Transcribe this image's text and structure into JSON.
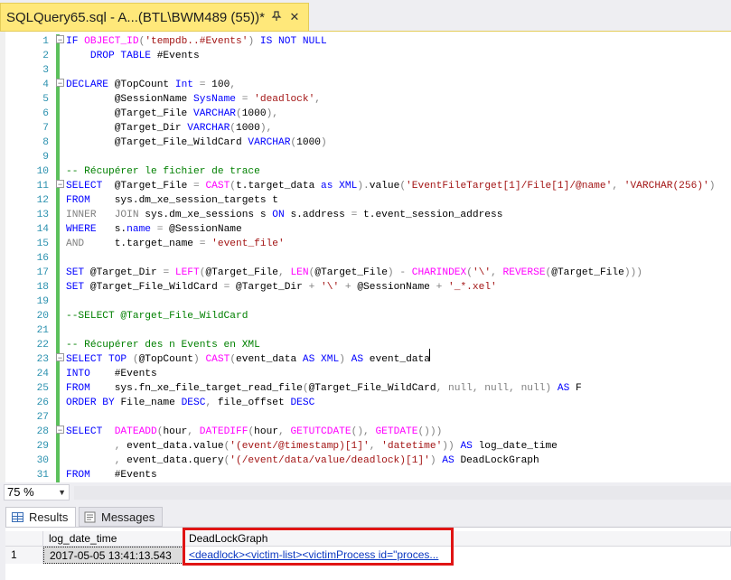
{
  "tab": {
    "title": "SQLQuery65.sql - A...(BTL\\BWM489 (55))*",
    "pin_icon": "pin-icon",
    "close_icon": "close-icon"
  },
  "editor": {
    "lines": [
      {
        "n": "1",
        "t": [
          [
            "k",
            "IF "
          ],
          [
            "f",
            "OBJECT_ID"
          ],
          [
            "g",
            "("
          ],
          [
            "s",
            "'tempdb..#Events'"
          ],
          [
            "g",
            ")"
          ],
          [
            "k",
            " IS NOT NULL"
          ]
        ]
      },
      {
        "n": "2",
        "t": [
          [
            "k",
            "    DROP TABLE "
          ],
          [
            "",
            "#Events"
          ]
        ]
      },
      {
        "n": "3",
        "t": []
      },
      {
        "n": "4",
        "t": [
          [
            "k",
            "DECLARE "
          ],
          [
            "",
            "@TopCount "
          ],
          [
            "k",
            "Int "
          ],
          [
            "g",
            "= "
          ],
          [
            "",
            "100"
          ],
          [
            "g",
            ","
          ]
        ]
      },
      {
        "n": "5",
        "t": [
          [
            "",
            "        @SessionName "
          ],
          [
            "k",
            "SysName "
          ],
          [
            "g",
            "= "
          ],
          [
            "s",
            "'deadlock'"
          ],
          [
            "g",
            ","
          ]
        ]
      },
      {
        "n": "6",
        "t": [
          [
            "",
            "        @Target_File "
          ],
          [
            "k",
            "VARCHAR"
          ],
          [
            "g",
            "("
          ],
          [
            "",
            "1000"
          ],
          [
            "g",
            "),"
          ]
        ]
      },
      {
        "n": "7",
        "t": [
          [
            "",
            "        @Target_Dir "
          ],
          [
            "k",
            "VARCHAR"
          ],
          [
            "g",
            "("
          ],
          [
            "",
            "1000"
          ],
          [
            "g",
            "),"
          ]
        ]
      },
      {
        "n": "8",
        "t": [
          [
            "",
            "        @Target_File_WildCard "
          ],
          [
            "k",
            "VARCHAR"
          ],
          [
            "g",
            "("
          ],
          [
            "",
            "1000"
          ],
          [
            "g",
            ")"
          ]
        ]
      },
      {
        "n": "9",
        "t": []
      },
      {
        "n": "10",
        "t": [
          [
            "c",
            "-- Récupérer le fichier de trace"
          ]
        ]
      },
      {
        "n": "11",
        "t": [
          [
            "k",
            "SELECT  "
          ],
          [
            "",
            "@Target_File "
          ],
          [
            "g",
            "= "
          ],
          [
            "f",
            "CAST"
          ],
          [
            "g",
            "("
          ],
          [
            "",
            "t.target_data "
          ],
          [
            "k",
            "as XML"
          ],
          [
            "g",
            ")."
          ],
          [
            "",
            "value"
          ],
          [
            "g",
            "("
          ],
          [
            "s",
            "'EventFileTarget[1]/File[1]/@name'"
          ],
          [
            "g",
            ", "
          ],
          [
            "s",
            "'VARCHAR(256)'"
          ],
          [
            "g",
            ")"
          ]
        ]
      },
      {
        "n": "12",
        "t": [
          [
            "k",
            "FROM    "
          ],
          [
            "",
            "sys.dm_xe_session_targets t"
          ]
        ]
      },
      {
        "n": "13",
        "t": [
          [
            "g",
            "INNER   JOIN "
          ],
          [
            "",
            "sys.dm_xe_sessions s "
          ],
          [
            "k",
            "ON "
          ],
          [
            "",
            "s.address "
          ],
          [
            "g",
            "= "
          ],
          [
            "",
            "t.event_session_address"
          ]
        ]
      },
      {
        "n": "14",
        "t": [
          [
            "k",
            "WHERE   "
          ],
          [
            "",
            "s."
          ],
          [
            "k",
            "name "
          ],
          [
            "g",
            "= "
          ],
          [
            "",
            "@SessionName"
          ]
        ]
      },
      {
        "n": "15",
        "t": [
          [
            "g",
            "AND     "
          ],
          [
            "",
            "t.target_name "
          ],
          [
            "g",
            "= "
          ],
          [
            "s",
            "'event_file'"
          ]
        ]
      },
      {
        "n": "16",
        "t": []
      },
      {
        "n": "17",
        "t": [
          [
            "k",
            "SET "
          ],
          [
            "",
            "@Target_Dir "
          ],
          [
            "g",
            "= "
          ],
          [
            "f",
            "LEFT"
          ],
          [
            "g",
            "("
          ],
          [
            "",
            "@Target_File"
          ],
          [
            "g",
            ", "
          ],
          [
            "f",
            "LEN"
          ],
          [
            "g",
            "("
          ],
          [
            "",
            "@Target_File"
          ],
          [
            "g",
            ") - "
          ],
          [
            "f",
            "CHARINDEX"
          ],
          [
            "g",
            "("
          ],
          [
            "s",
            "'\\'"
          ],
          [
            "g",
            ", "
          ],
          [
            "f",
            "REVERSE"
          ],
          [
            "g",
            "("
          ],
          [
            "",
            "@Target_File"
          ],
          [
            "g",
            ")))"
          ]
        ]
      },
      {
        "n": "18",
        "t": [
          [
            "k",
            "SET "
          ],
          [
            "",
            "@Target_File_WildCard "
          ],
          [
            "g",
            "= "
          ],
          [
            "",
            "@Target_Dir "
          ],
          [
            "g",
            "+ "
          ],
          [
            "s",
            "'\\' "
          ],
          [
            "g",
            "+ "
          ],
          [
            "",
            "@SessionName "
          ],
          [
            "g",
            "+ "
          ],
          [
            "s",
            "'_*.xel'"
          ]
        ]
      },
      {
        "n": "19",
        "t": []
      },
      {
        "n": "20",
        "t": [
          [
            "c",
            "--SELECT @Target_File_WildCard"
          ]
        ]
      },
      {
        "n": "21",
        "t": []
      },
      {
        "n": "22",
        "t": [
          [
            "c",
            "-- Récupérer des n Events en XML"
          ]
        ]
      },
      {
        "n": "23",
        "t": [
          [
            "k",
            "SELECT TOP "
          ],
          [
            "g",
            "("
          ],
          [
            "",
            "@TopCount"
          ],
          [
            "g",
            ") "
          ],
          [
            "f",
            "CAST"
          ],
          [
            "g",
            "("
          ],
          [
            "",
            "event_data "
          ],
          [
            "k",
            "AS XML"
          ],
          [
            "g",
            ") "
          ],
          [
            "k",
            "AS "
          ],
          [
            "",
            "event_data"
          ]
        ]
      },
      {
        "n": "24",
        "t": [
          [
            "k",
            "INTO    "
          ],
          [
            "",
            "#Events"
          ]
        ]
      },
      {
        "n": "25",
        "t": [
          [
            "k",
            "FROM    "
          ],
          [
            "",
            "sys.fn_xe_file_target_read_file"
          ],
          [
            "g",
            "("
          ],
          [
            "",
            "@Target_File_WildCard"
          ],
          [
            "g",
            ", "
          ],
          [
            "g",
            "null, null, null"
          ],
          [
            "g",
            ") "
          ],
          [
            "k",
            "AS "
          ],
          [
            "",
            "F"
          ]
        ]
      },
      {
        "n": "26",
        "t": [
          [
            "k",
            "ORDER BY "
          ],
          [
            "",
            "File_name "
          ],
          [
            "k",
            "DESC"
          ],
          [
            "g",
            ", "
          ],
          [
            "",
            "file_offset "
          ],
          [
            "k",
            "DESC"
          ]
        ]
      },
      {
        "n": "27",
        "t": []
      },
      {
        "n": "28",
        "t": [
          [
            "k",
            "SELECT  "
          ],
          [
            "f",
            "DATEADD"
          ],
          [
            "g",
            "("
          ],
          [
            "",
            "hour"
          ],
          [
            "g",
            ", "
          ],
          [
            "f",
            "DATEDIFF"
          ],
          [
            "g",
            "("
          ],
          [
            "",
            "hour"
          ],
          [
            "g",
            ", "
          ],
          [
            "f",
            "GETUTCDATE"
          ],
          [
            "g",
            "(), "
          ],
          [
            "f",
            "GETDATE"
          ],
          [
            "g",
            "()))"
          ]
        ]
      },
      {
        "n": "29",
        "t": [
          [
            "g",
            "        , "
          ],
          [
            "",
            "event_data.value"
          ],
          [
            "g",
            "("
          ],
          [
            "s",
            "'(event/@timestamp)[1]'"
          ],
          [
            "g",
            ", "
          ],
          [
            "s",
            "'datetime'"
          ],
          [
            "g",
            ")) "
          ],
          [
            "k",
            "AS "
          ],
          [
            "",
            "log_date_time"
          ]
        ]
      },
      {
        "n": "30",
        "t": [
          [
            "g",
            "        , "
          ],
          [
            "",
            "event_data.query"
          ],
          [
            "g",
            "("
          ],
          [
            "s",
            "'(/event/data/value/deadlock)[1]'"
          ],
          [
            "g",
            ") "
          ],
          [
            "k",
            "AS "
          ],
          [
            "",
            "DeadLockGraph"
          ]
        ]
      },
      {
        "n": "31",
        "t": [
          [
            "k",
            "FROM    "
          ],
          [
            "",
            "#Events"
          ]
        ]
      }
    ]
  },
  "zoom": {
    "value": "75 %"
  },
  "results": {
    "tabs": {
      "results_label": "Results",
      "messages_label": "Messages"
    },
    "columns": {
      "c1": "log_date_time",
      "c2": "DeadLockGraph"
    },
    "rows": [
      {
        "num": "1",
        "log_date_time": "2017-05-05 13:41:13.543",
        "deadlock": "<deadlock><victim-list><victimProcess id=\"proces..."
      }
    ]
  }
}
